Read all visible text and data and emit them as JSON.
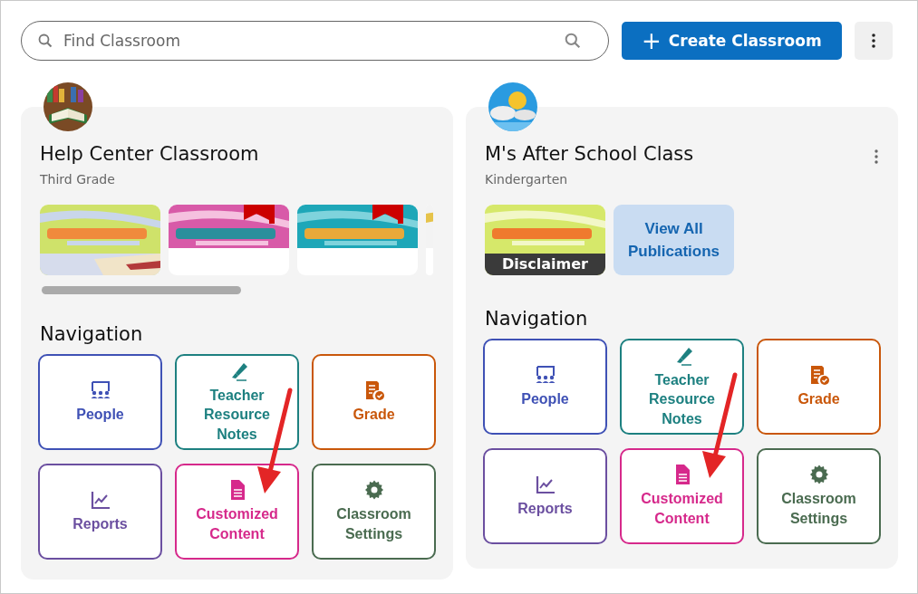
{
  "search": {
    "placeholder": "Find Classroom"
  },
  "create_button": {
    "icon": "+",
    "label": "Create Classroom"
  },
  "classrooms": [
    {
      "name": "Help Center Classroom",
      "grade": "Third Grade",
      "menu": false,
      "scrollbar": true,
      "callout_arrow": true,
      "publications": [
        {
          "kind": "picture",
          "bookmarked": false
        },
        {
          "kind": "picture",
          "bookmarked": true
        },
        {
          "kind": "picture",
          "bookmarked": true
        },
        {
          "kind": "partial"
        }
      ],
      "navigation_heading": "Navigation",
      "navigation": [
        {
          "kind": "people",
          "label": "People",
          "color": "#3f51b5"
        },
        {
          "kind": "notes",
          "label": "Teacher Resource Notes",
          "color": "#1d8080"
        },
        {
          "kind": "grade",
          "label": "Grade",
          "color": "#c9570a"
        },
        {
          "kind": "reports",
          "label": "Reports",
          "color": "#6b4fa0"
        },
        {
          "kind": "content",
          "label": "Customized Content",
          "color": "#d6298b"
        },
        {
          "kind": "settings",
          "label": "Classroom Settings",
          "color": "#4a6b50"
        }
      ]
    },
    {
      "name": "M's After School Class",
      "grade": "Kindergarten",
      "menu": true,
      "scrollbar": false,
      "callout_arrow": true,
      "publications": [
        {
          "kind": "picture",
          "bookmarked": false,
          "caption": "Disclaimer"
        },
        {
          "kind": "view_all",
          "label": "View All Publications"
        }
      ],
      "navigation_heading": "Navigation",
      "navigation": [
        {
          "kind": "people",
          "label": "People",
          "color": "#3f51b5"
        },
        {
          "kind": "notes",
          "label": "Teacher Resource Notes",
          "color": "#1d8080"
        },
        {
          "kind": "grade",
          "label": "Grade",
          "color": "#c9570a"
        },
        {
          "kind": "reports",
          "label": "Reports",
          "color": "#6b4fa0"
        },
        {
          "kind": "content",
          "label": "Customized Content",
          "color": "#d6298b"
        },
        {
          "kind": "settings",
          "label": "Classroom Settings",
          "color": "#4a6b50"
        }
      ]
    }
  ]
}
